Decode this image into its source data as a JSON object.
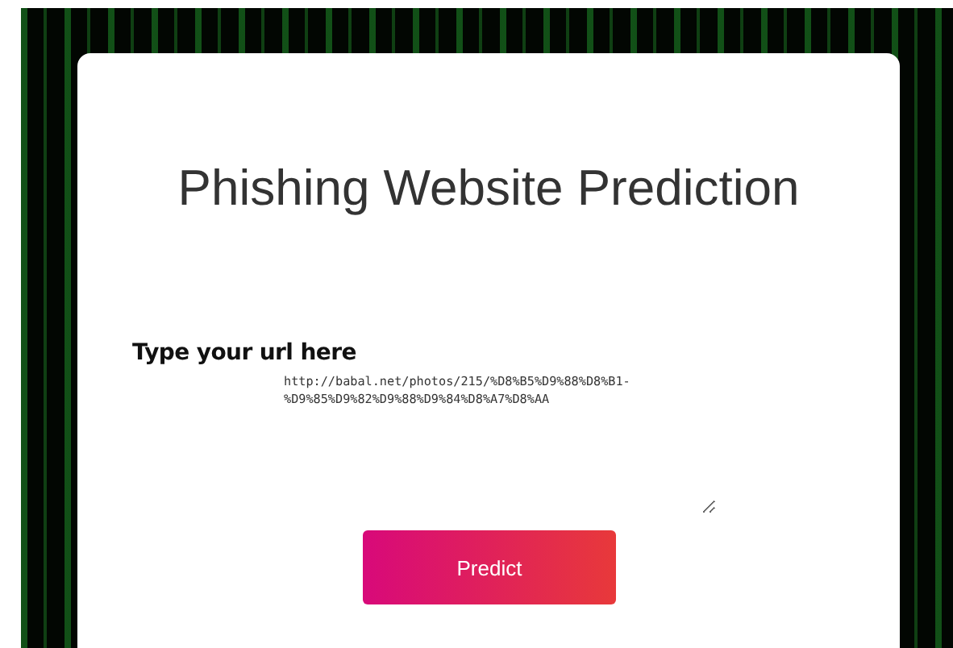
{
  "title": "Phishing Website Prediction",
  "url_field": {
    "label": "Type your url here",
    "value": "http://babal.net/photos/215/%D8%B5%D9%88%D8%B1-%D9%85%D9%82%D9%88%D9%84%D8%A7%D8%AA"
  },
  "button": "Predict"
}
